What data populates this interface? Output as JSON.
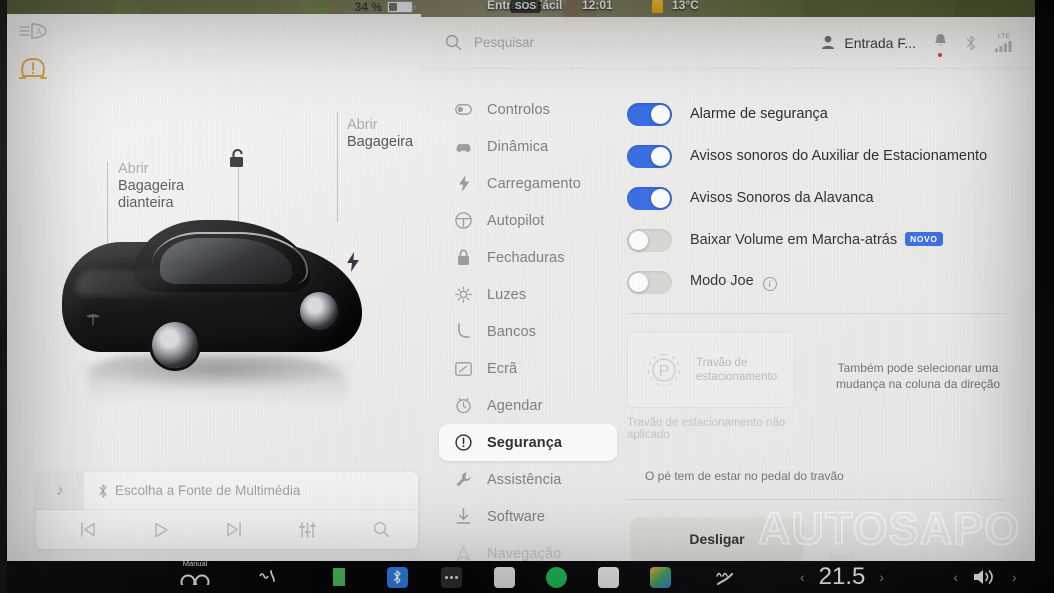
{
  "status_strip": {
    "destination": "Entrada Fácil",
    "sos": "SOS",
    "clock": "12:01",
    "temperature": "13°C"
  },
  "vehicle": {
    "battery_percent": "34 %",
    "indicators": [
      {
        "name": "auto-headlight-icon",
        "state": "inactive"
      },
      {
        "name": "tire-pressure-warning-icon",
        "state": "amber"
      }
    ],
    "callouts": [
      {
        "line1": "Abrir",
        "line2": "Bagageira",
        "line3": "dianteira"
      },
      {
        "line1": "Abrir",
        "line2": "Bagageira",
        "line3": ""
      }
    ],
    "lock_state": "unlocked",
    "charge_port_icon": "bolt-icon"
  },
  "media": {
    "source_label": "Escolha a Fonte de Multimédia",
    "source_icon": "bluetooth-icon",
    "album_icon": "music-note-icon",
    "controls": [
      {
        "name": "previous-track-button",
        "glyph": "prev"
      },
      {
        "name": "play-button",
        "glyph": "play"
      },
      {
        "name": "next-track-button",
        "glyph": "next"
      },
      {
        "name": "equalizer-button",
        "glyph": "eq"
      },
      {
        "name": "search-media-button",
        "glyph": "search"
      }
    ]
  },
  "topbar": {
    "search_placeholder": "Pesquisar",
    "profile_name": "Entrada F...",
    "lte_label": "LTE"
  },
  "sidebar": {
    "items": [
      {
        "label": "Controlos",
        "icon": "toggle-icon",
        "state": "normal"
      },
      {
        "label": "Dinâmica",
        "icon": "car-icon",
        "state": "normal"
      },
      {
        "label": "Carregamento",
        "icon": "bolt-icon",
        "state": "normal"
      },
      {
        "label": "Autopilot",
        "icon": "steering-wheel-icon",
        "state": "normal"
      },
      {
        "label": "Fechaduras",
        "icon": "lock-icon",
        "state": "normal"
      },
      {
        "label": "Luzes",
        "icon": "sun-icon",
        "state": "normal"
      },
      {
        "label": "Bancos",
        "icon": "seat-icon",
        "state": "normal"
      },
      {
        "label": "Ecrã",
        "icon": "display-icon",
        "state": "normal"
      },
      {
        "label": "Agendar",
        "icon": "clock-icon",
        "state": "normal"
      },
      {
        "label": "Segurança",
        "icon": "alert-circle-icon",
        "state": "active"
      },
      {
        "label": "Assistência",
        "icon": "wrench-icon",
        "state": "normal"
      },
      {
        "label": "Software",
        "icon": "download-icon",
        "state": "normal"
      },
      {
        "label": "Navegação",
        "icon": "navigation-icon",
        "state": "faded"
      }
    ]
  },
  "settings": {
    "toggles": [
      {
        "label": "Alarme de segurança",
        "on": true,
        "badge": "",
        "info": false
      },
      {
        "label": "Avisos sonoros do Auxiliar de Estacionamento",
        "on": true,
        "badge": "",
        "info": false
      },
      {
        "label": "Avisos Sonoros da Alavanca",
        "on": true,
        "badge": "",
        "info": false
      },
      {
        "label": "Baixar Volume em Marcha-atrás",
        "on": false,
        "badge": "NOVO",
        "info": false
      },
      {
        "label": "Modo Joe",
        "on": false,
        "badge": "",
        "info": true
      }
    ],
    "parking_brake": {
      "card_label_line1": "Travão de",
      "card_label_line2": "estacionamento",
      "card_icon": "parking-brake-p-icon",
      "status": "Travão de estacionamento não aplicado",
      "hint": "Também pode selecionar uma mudança na coluna da direção",
      "footnote": "O pé tem de estar no pedal do travão"
    },
    "off_button_label": "Desligar"
  },
  "taskbar": {
    "gear_label": "Manual",
    "climate_label": "Manual",
    "temperature": "21.5",
    "items": [
      {
        "name": "glovebox-icon"
      },
      {
        "name": "spotify-icon"
      },
      {
        "name": "notes-icon"
      },
      {
        "name": "apps-icon"
      },
      {
        "name": "defrost-icon"
      }
    ],
    "left_icons": [
      {
        "name": "wiper-icon"
      },
      {
        "name": "seat-heater-icon"
      },
      {
        "name": "bluetooth-icon"
      },
      {
        "name": "more-icon"
      }
    ]
  },
  "watermark": {
    "text": "AUTOSAPO"
  },
  "colors": {
    "accent_blue": "#3a6fe3",
    "panel_bg": "#efeeec",
    "active_item_bg": "#fafafa",
    "warning_amber": "#e8a53a"
  }
}
